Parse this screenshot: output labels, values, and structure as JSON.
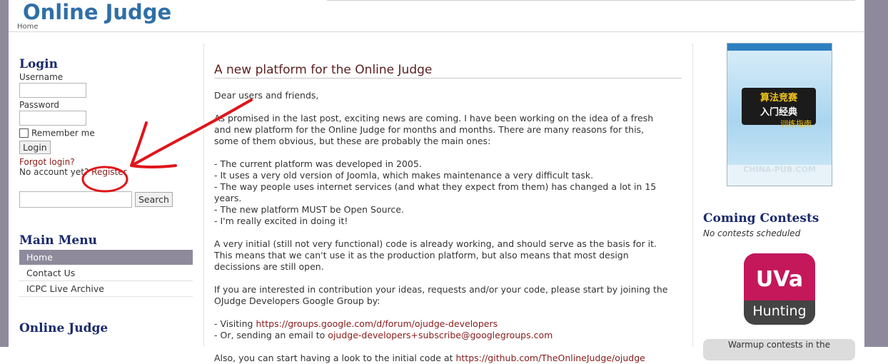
{
  "header": {
    "logo": "Online Judge",
    "breadcrumb": "Home"
  },
  "login": {
    "title": "Login",
    "username_label": "Username",
    "password_label": "Password",
    "remember_label": "Remember me",
    "login_button": "Login",
    "forgot_link": "Forgot login?",
    "no_account": "No account yet?",
    "register_link": "Register",
    "search_button": "Search"
  },
  "main_menu": {
    "title": "Main Menu",
    "items": [
      {
        "label": "Home"
      },
      {
        "label": "Contact Us"
      },
      {
        "label": "ICPC Live Archive"
      }
    ]
  },
  "left_bottom_title": "Online Judge",
  "article": {
    "title": "A new platform for the Online Judge",
    "greeting": "Dear users and friends,",
    "p1": "As promised in the last post, exciting news are coming. I have been working on the idea of a fresh and new platform for the Online Judge for months and months. There are many reasons for this, some of them obvious, but these are probably the main ones:",
    "bullets": [
      "- The current platform was developed in 2005.",
      "- It uses a very old version of Joomla, which makes maintenance a very difficult task.",
      "- The way people uses internet services (and what they expect from them) has changed a lot in 15 years.",
      "- The new platform MUST be Open Source.",
      "- I'm really excited in doing it!"
    ],
    "p2": "A very initial (still not very functional) code is already working, and should serve as the basis for it.  This means that we can't use it as the production platform, but also means that most design decissions are still open.",
    "p3": "If you are interested in contribution your ideas, requests and/or your code, please start by joining the OJudge Developers Google Group by:",
    "visit_prefix": "- Visiting ",
    "visit_link": "https://groups.google.com/d/forum/ojudge-developers",
    "email_prefix": "- Or, sending an email to ",
    "email_link": "ojudge-developers+subscribe@googlegroups.com",
    "also_prefix": "Also, you can start having a look to the initial code at ",
    "also_link": "https://github.com/TheOnlineJudge/ojudge"
  },
  "right": {
    "book_title_line1": "算法竞赛",
    "book_title_line2": "入门经典",
    "book_subtitle": "训练指南",
    "book_watermark": "CHINA-PUB.COM",
    "coming_title": "Coming Contests",
    "coming_empty": "No contests scheduled",
    "uva_top": "UVa",
    "uva_bottom": "Hunting",
    "warmup": "Warmup contests in the"
  },
  "colors": {
    "accent": "#8e8a9c",
    "link": "#8a1a1a",
    "heading": "#1a2a6c",
    "logo": "#2f6fa7",
    "annotation": "#e0151a"
  }
}
